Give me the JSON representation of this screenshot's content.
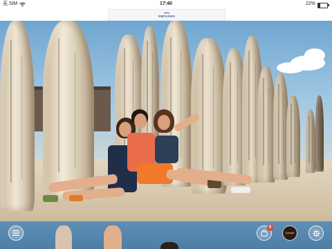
{
  "status_bar": {
    "carrier": "无 SIM",
    "time": "17:40",
    "battery_text": "22%",
    "battery_level": 0.22
  },
  "header": {
    "brand_name": "SWIXANS"
  },
  "bottom_bar": {
    "cart_badge_count": "0",
    "avatar_caption": "Summer"
  },
  "colors": {
    "bottom_bar": "#557fa8",
    "badge": "#e8433a",
    "brand_text": "#2a4f86"
  },
  "icons": {
    "menu": "menu-icon",
    "cart": "shopping-bag-icon",
    "settings": "gear-icon",
    "wifi": "wifi-icon"
  }
}
